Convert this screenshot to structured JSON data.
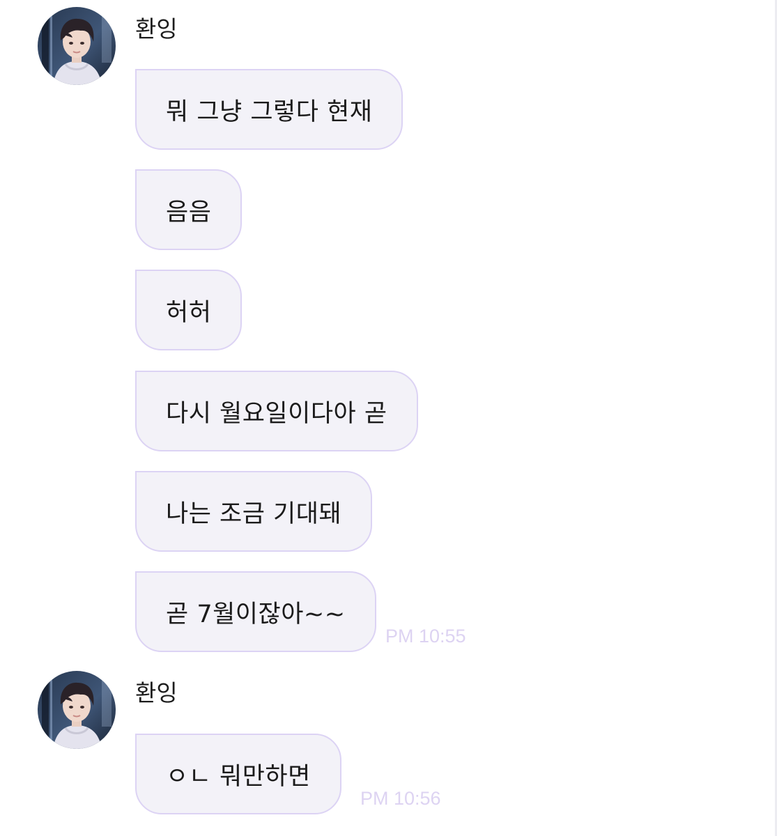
{
  "groups": [
    {
      "sender": {
        "name": "환잉",
        "avatar": "avatar-photo"
      },
      "messages": [
        {
          "text": "뭐 그냥 그렇다 현재"
        },
        {
          "text": "음음"
        },
        {
          "text": "허허"
        },
        {
          "text": "다시 월요일이다아 곧"
        },
        {
          "text": "나는 조금 기대돼"
        },
        {
          "text": "곧 7월이잖아~~"
        }
      ],
      "timestamp": "PM 10:55"
    },
    {
      "sender": {
        "name": "환잉",
        "avatar": "avatar-photo"
      },
      "messages": [
        {
          "text": "ㅇㄴ 뭐만하면"
        }
      ],
      "timestamp": "PM 10:56"
    }
  ],
  "colors": {
    "bubble_fill": "#f3f2f8",
    "bubble_border": "#dcd3f4",
    "timestamp": "#ddd3f2",
    "text": "#1b1b1b"
  }
}
